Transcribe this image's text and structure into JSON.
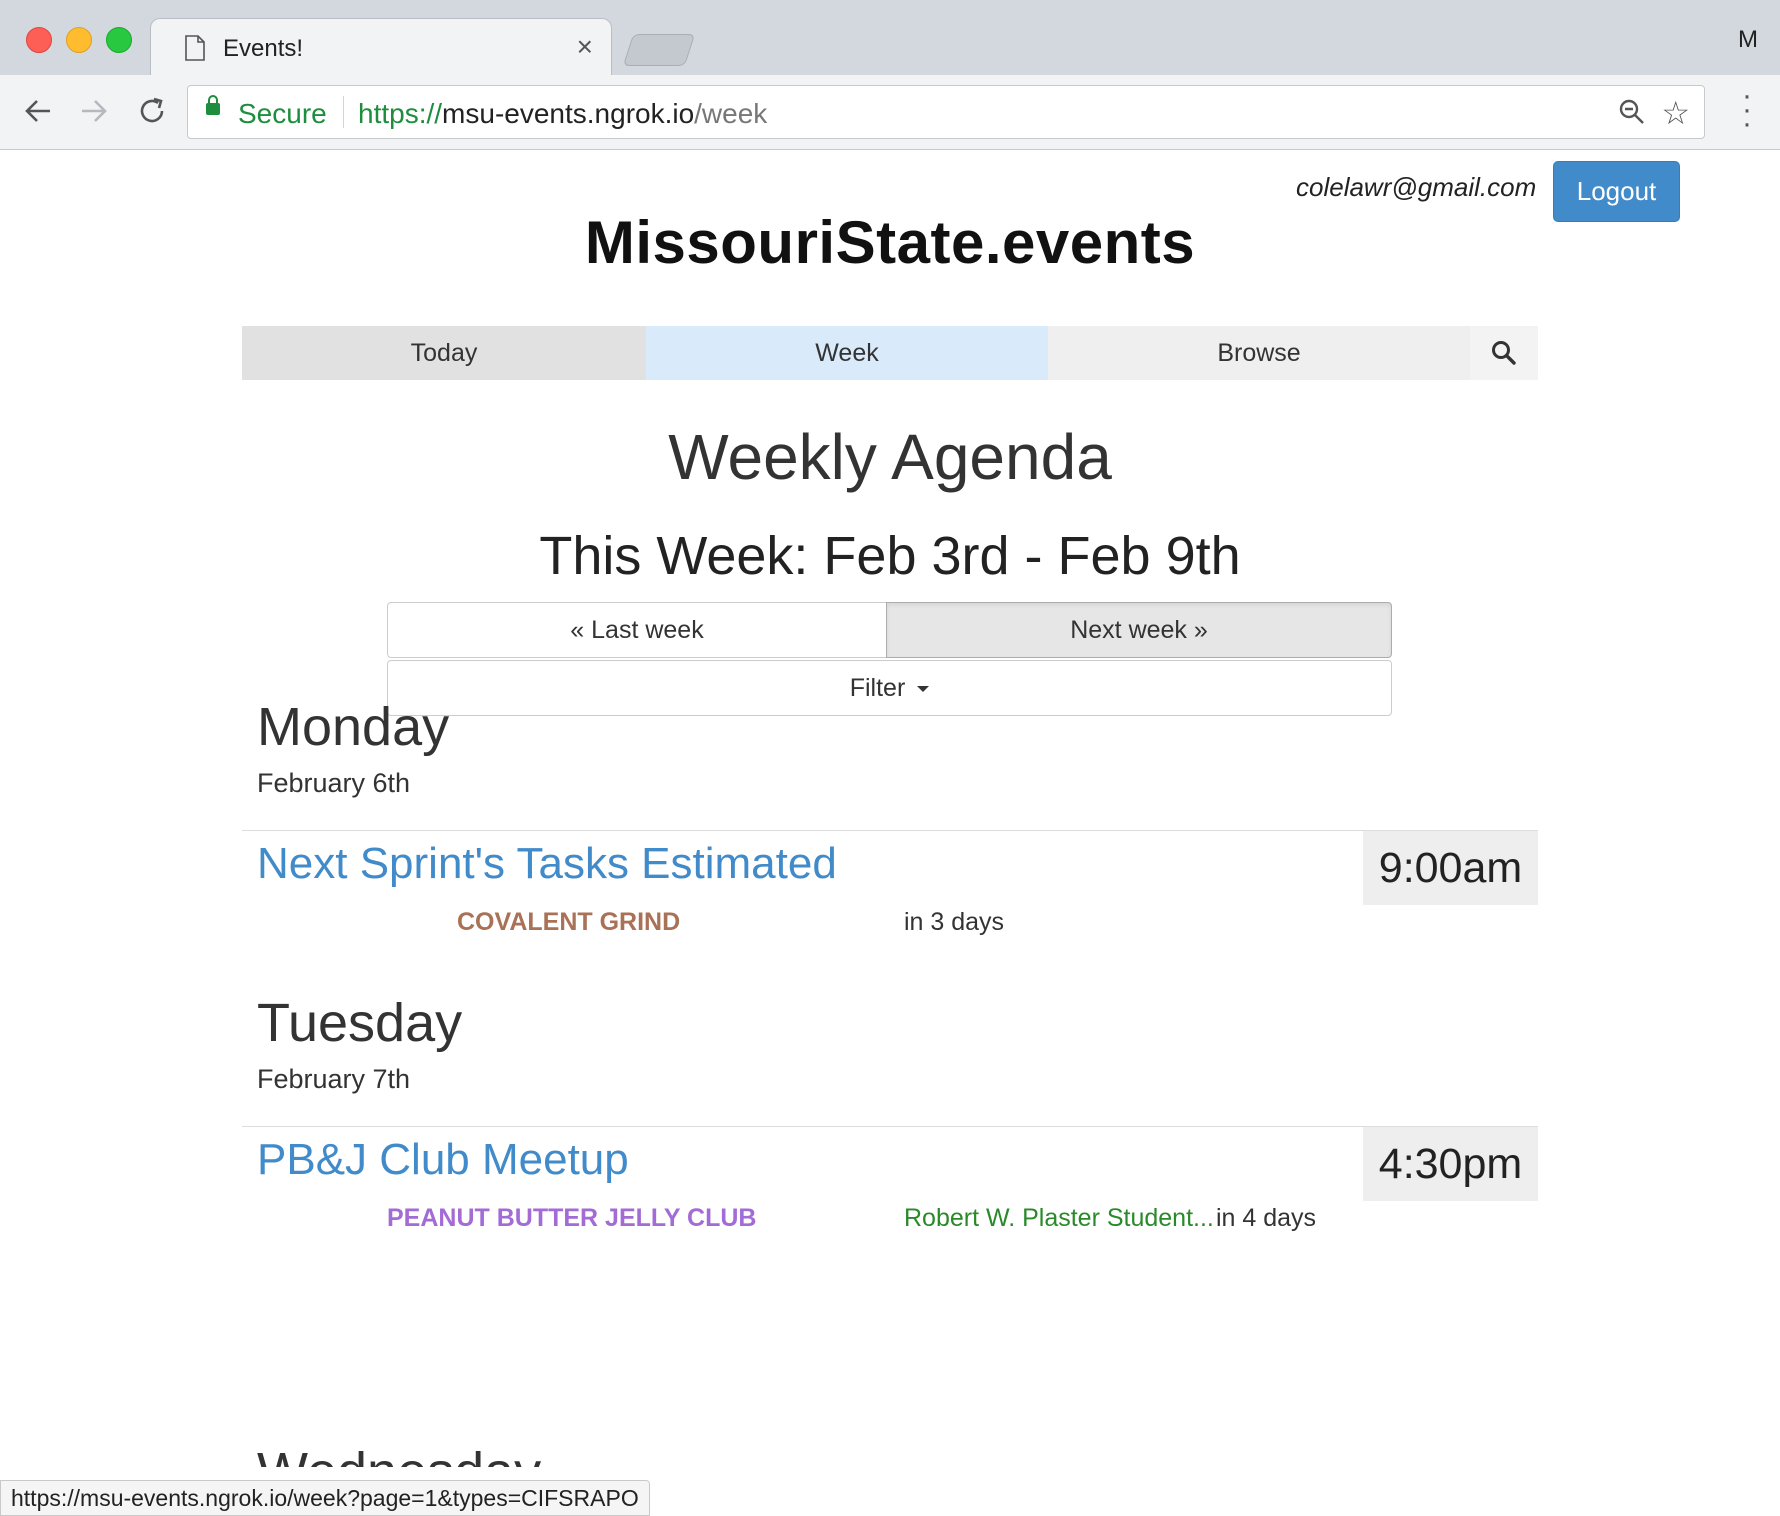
{
  "browser": {
    "tab_title": "Events!",
    "profile_initial": "M",
    "secure_label": "Secure",
    "url_scheme": "https://",
    "url_host": "msu-events.ngrok.io",
    "url_path": "/week",
    "status_url": "https://msu-events.ngrok.io/week?page=1&types=CIFSRAPO"
  },
  "header": {
    "user_email": "colelawr@gmail.com",
    "logout_label": "Logout",
    "logo_text": "MissouriState.events"
  },
  "nav": {
    "today": "Today",
    "week": "Week",
    "browse": "Browse",
    "active": "Week"
  },
  "agenda": {
    "heading": "Weekly Agenda",
    "week_range": "This Week: Feb 3rd - Feb 9th",
    "last_week_label": "« Last week",
    "next_week_label": "Next week »",
    "filter_label": "Filter"
  },
  "days": [
    {
      "name": "Monday",
      "date": "February 6th",
      "events": [
        {
          "title": "Next Sprint's Tasks Estimated",
          "time": "9:00am",
          "org": "COVALENT GRIND",
          "org_color": "#a97155",
          "location": "",
          "relative": "in 3 days"
        }
      ]
    },
    {
      "name": "Tuesday",
      "date": "February 7th",
      "events": [
        {
          "title": "PB&J Club Meetup",
          "time": "4:30pm",
          "org": "PEANUT BUTTER JELLY CLUB",
          "org_color": "#a36bd6",
          "location": "Robert W. Plaster Student...",
          "relative": "in 4 days"
        }
      ]
    },
    {
      "name": "Wednesday"
    }
  ],
  "colors": {
    "link_blue": "#428bca",
    "location_green": "#2a8a2a",
    "secure_green": "#1e8e3e"
  }
}
